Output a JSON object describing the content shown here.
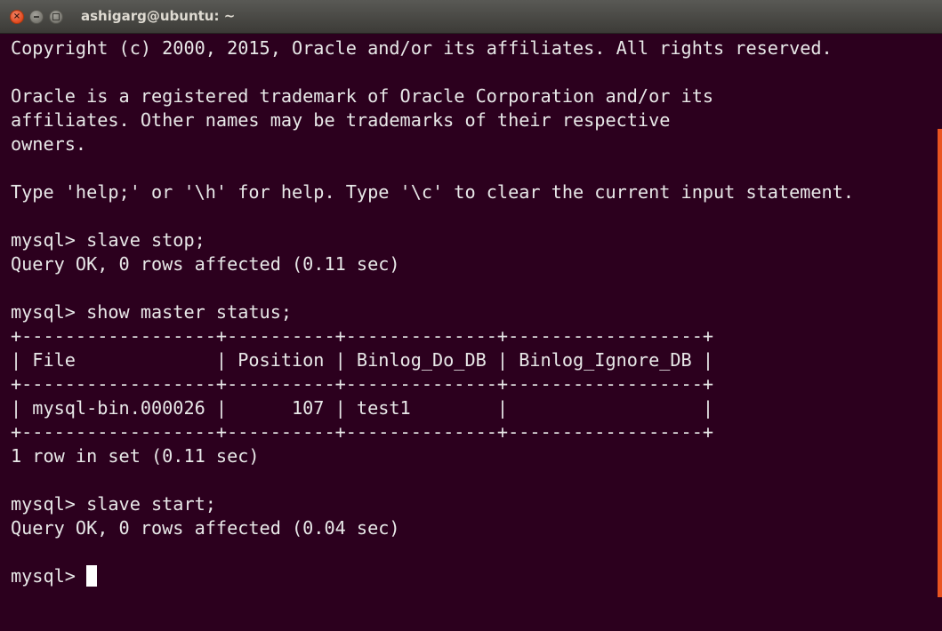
{
  "window": {
    "title": "ashigarg@ubuntu: ~"
  },
  "colors": {
    "background": "#2c001e",
    "text": "#e8e8e8",
    "titlebar": "#3c3b37",
    "close_button": "#e0491e",
    "scrollbar": "#e95420"
  },
  "icons": {
    "close": "close-icon",
    "minimize": "minimize-icon",
    "maximize": "maximize-icon"
  },
  "terminal": {
    "lines": [
      "Copyright (c) 2000, 2015, Oracle and/or its affiliates. All rights reserved.",
      "",
      "Oracle is a registered trademark of Oracle Corporation and/or its",
      "affiliates. Other names may be trademarks of their respective",
      "owners.",
      "",
      "Type 'help;' or '\\h' for help. Type '\\c' to clear the current input statement.",
      "",
      "mysql> slave stop;",
      "Query OK, 0 rows affected (0.11 sec)",
      "",
      "mysql> show master status;",
      "+------------------+----------+--------------+------------------+",
      "| File             | Position | Binlog_Do_DB | Binlog_Ignore_DB |",
      "+------------------+----------+--------------+------------------+",
      "| mysql-bin.000026 |      107 | test1        |                  |",
      "+------------------+----------+--------------+------------------+",
      "1 row in set (0.11 sec)",
      "",
      "mysql> slave start;",
      "Query OK, 0 rows affected (0.04 sec)",
      ""
    ],
    "prompt": "mysql> "
  }
}
